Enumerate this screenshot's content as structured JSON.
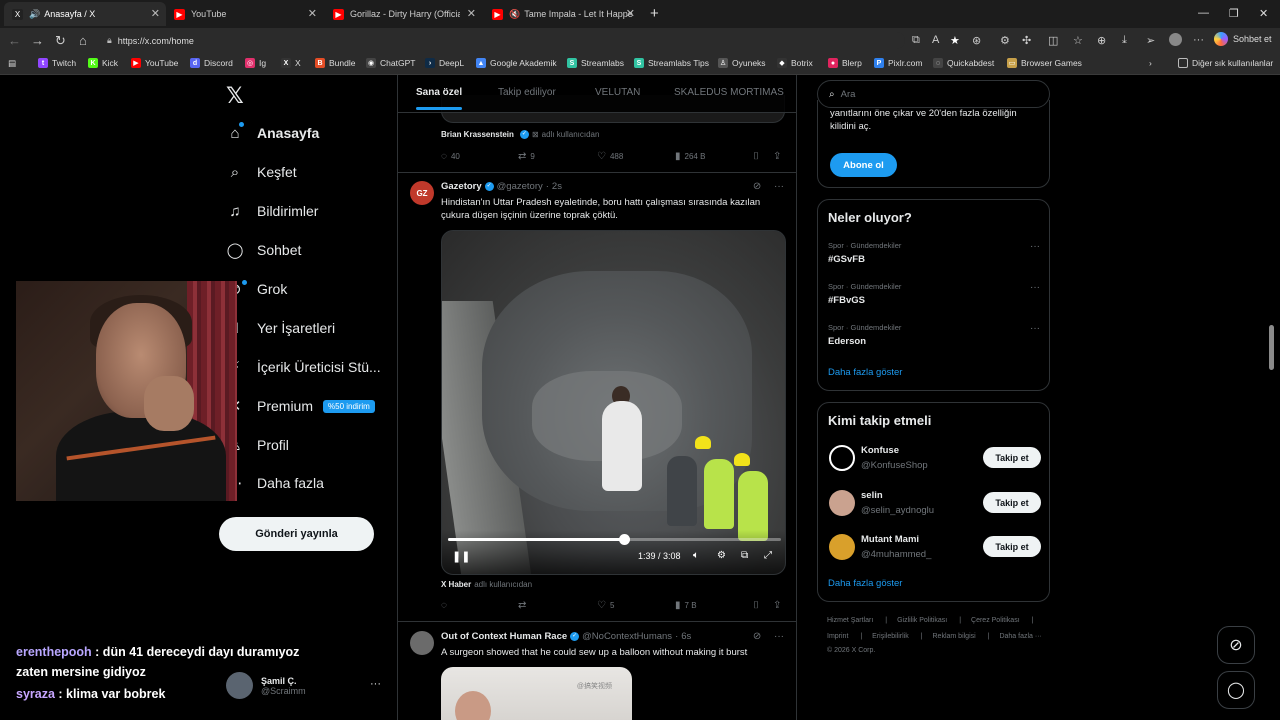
{
  "browser": {
    "tabs": [
      {
        "title": "Anasayfa / X",
        "icon": "x-icon",
        "color": "#222222"
      },
      {
        "title": "YouTube",
        "icon": "youtube-icon",
        "color": "#ff0000"
      },
      {
        "title": "Gorillaz - Dirty Harry (Official Vide",
        "icon": "youtube-icon",
        "color": "#ff0000"
      },
      {
        "title": "Tame Impala - Let It Happen (",
        "icon": "youtube-icon",
        "color": "#ff0000"
      }
    ],
    "url": "https://x.com/home",
    "copilot_label": "Sohbet et",
    "bookmarks": [
      {
        "label": "Twitch",
        "color": "#9146ff",
        "glyph": "t"
      },
      {
        "label": "Kick",
        "color": "#53fc18",
        "glyph": "K"
      },
      {
        "label": "YouTube",
        "color": "#ff0000",
        "glyph": "▶"
      },
      {
        "label": "Discord",
        "color": "#5865f2",
        "glyph": "d"
      },
      {
        "label": "Ig",
        "color": "#e1306c",
        "glyph": "◎"
      },
      {
        "label": "X",
        "color": "#333333",
        "glyph": "X"
      },
      {
        "label": "Bundle",
        "color": "#e44d26",
        "glyph": "B"
      },
      {
        "label": "ChatGPT",
        "color": "#444444",
        "glyph": "◉"
      },
      {
        "label": "DeepL",
        "color": "#0f2b46",
        "glyph": "›"
      },
      {
        "label": "Google Akademik",
        "color": "#4285f4",
        "glyph": "▲"
      },
      {
        "label": "Streamlabs",
        "color": "#31c3a2",
        "glyph": "S"
      },
      {
        "label": "Streamlabs Tips",
        "color": "#31c3a2",
        "glyph": "S"
      },
      {
        "label": "Oyuneks",
        "color": "#555555",
        "glyph": "♙"
      },
      {
        "label": "Botrix",
        "color": "#333333",
        "glyph": "◆"
      },
      {
        "label": "Blerp",
        "color": "#e0245e",
        "glyph": "●"
      },
      {
        "label": "Pixlr.com",
        "color": "#2f80ed",
        "glyph": "P"
      },
      {
        "label": "Quickabdest",
        "color": "#444444",
        "glyph": "◌"
      },
      {
        "label": "Browser Games",
        "color": "#c7a04a",
        "glyph": "▭"
      }
    ],
    "other_bookmarks": "Diğer sık kullanılanlar"
  },
  "sidebar": {
    "items": [
      {
        "label": "Anasayfa",
        "icon": "home-icon",
        "glyph": "⌂"
      },
      {
        "label": "Keşfet",
        "icon": "search-icon",
        "glyph": "⌕"
      },
      {
        "label": "Bildirimler",
        "icon": "bell-icon",
        "glyph": "♫"
      },
      {
        "label": "Sohbet",
        "icon": "chat-icon",
        "glyph": "◯"
      },
      {
        "label": "Grok",
        "icon": "grok-icon",
        "glyph": "⊘"
      },
      {
        "label": "Yer İşaretleri",
        "icon": "bookmark-icon",
        "glyph": "⌷"
      },
      {
        "label": "İçerik Üreticisi Stü...",
        "icon": "creator-icon",
        "glyph": "⚡"
      },
      {
        "label": "Premium",
        "icon": "premium-icon",
        "glyph": "✕"
      },
      {
        "label": "Profil",
        "icon": "profile-icon",
        "glyph": "♙"
      },
      {
        "label": "Daha fazla",
        "icon": "more-icon",
        "glyph": "⋯"
      }
    ],
    "premium_badge": "%50 indirim",
    "post_button": "Gönderi yayınla",
    "account": {
      "name": "Şamil Ç.",
      "handle": "@Scraimm"
    }
  },
  "chat": [
    {
      "user": "erenthepooh",
      "text": " : dün 41 dereceydi dayı duramıyoz"
    },
    {
      "user": "",
      "text": "zaten mersine gidiyoz"
    },
    {
      "user": "syraza",
      "text": " : klima var bobrek"
    }
  ],
  "timeline": {
    "tabs": [
      "Sana özel",
      "Takip ediliyor",
      "VELUTAN",
      "SKALEDUS MORTIMAS"
    ],
    "prev_tweet": {
      "via_name": "Brian Krassenstein",
      "via_text": "adlı kullanıcıdan",
      "replies": "40",
      "reposts": "9",
      "likes": "488",
      "views": "264 B"
    },
    "tweet1": {
      "name": "Gazetory",
      "handle": "@gazetory",
      "time": "2s",
      "avatar": "GZ",
      "text": "Hindistan'ın Uttar Pradesh eyaletinde, boru hattı çalışması sırasında kazılan çukura düşen işçinin üzerine toprak çöktü.",
      "video_time": "1:39 / 3:08",
      "video_progress": 0.53,
      "via_name": "X Haber",
      "via_text": "adlı kullanıcıdan",
      "replies": "",
      "reposts": "",
      "likes": "5",
      "views": "7 B"
    },
    "tweet2": {
      "name": "Out of Context Human Race",
      "handle": "@NoContextHumans",
      "time": "6s",
      "text": "A surgeon showed that he could sew up a balloon without making it burst",
      "watermark": "@搞笑视频"
    }
  },
  "right": {
    "search_placeholder": "Ara",
    "premium_text": "yanıtlarını öne çıkar ve 20'den fazla özelliğin kilidini aç.",
    "subscribe": "Abone ol",
    "trends_title": "Neler oluyor?",
    "trends": [
      {
        "category": "Spor · Gündemdekiler",
        "tag": "#GSvFB"
      },
      {
        "category": "Spor · Gündemdekiler",
        "tag": "#FBvGS"
      },
      {
        "category": "Spor · Gündemdekiler",
        "tag": "Ederson"
      }
    ],
    "show_more": "Daha fazla göster",
    "who_title": "Kimi takip etmeli",
    "who": [
      {
        "name": "Konfuse",
        "handle": "@KonfuseShop",
        "follow": "Takip et",
        "color": "#ffffff"
      },
      {
        "name": "selin",
        "handle": "@selin_aydnoglu",
        "follow": "Takip et",
        "color": "#caa28f"
      },
      {
        "name": "Mutant Mami",
        "handle": "@4muhammed_",
        "follow": "Takip et",
        "color": "#d9a02b"
      }
    ],
    "footer_row1": [
      "Hizmet Şartları",
      "Gizlilik Politikası",
      "Çerez Politikası"
    ],
    "footer_row2": [
      "Imprint",
      "Erişilebilirlik",
      "Reklam bilgisi",
      "Daha fazla ···"
    ],
    "copyright": "© 2026 X Corp."
  }
}
